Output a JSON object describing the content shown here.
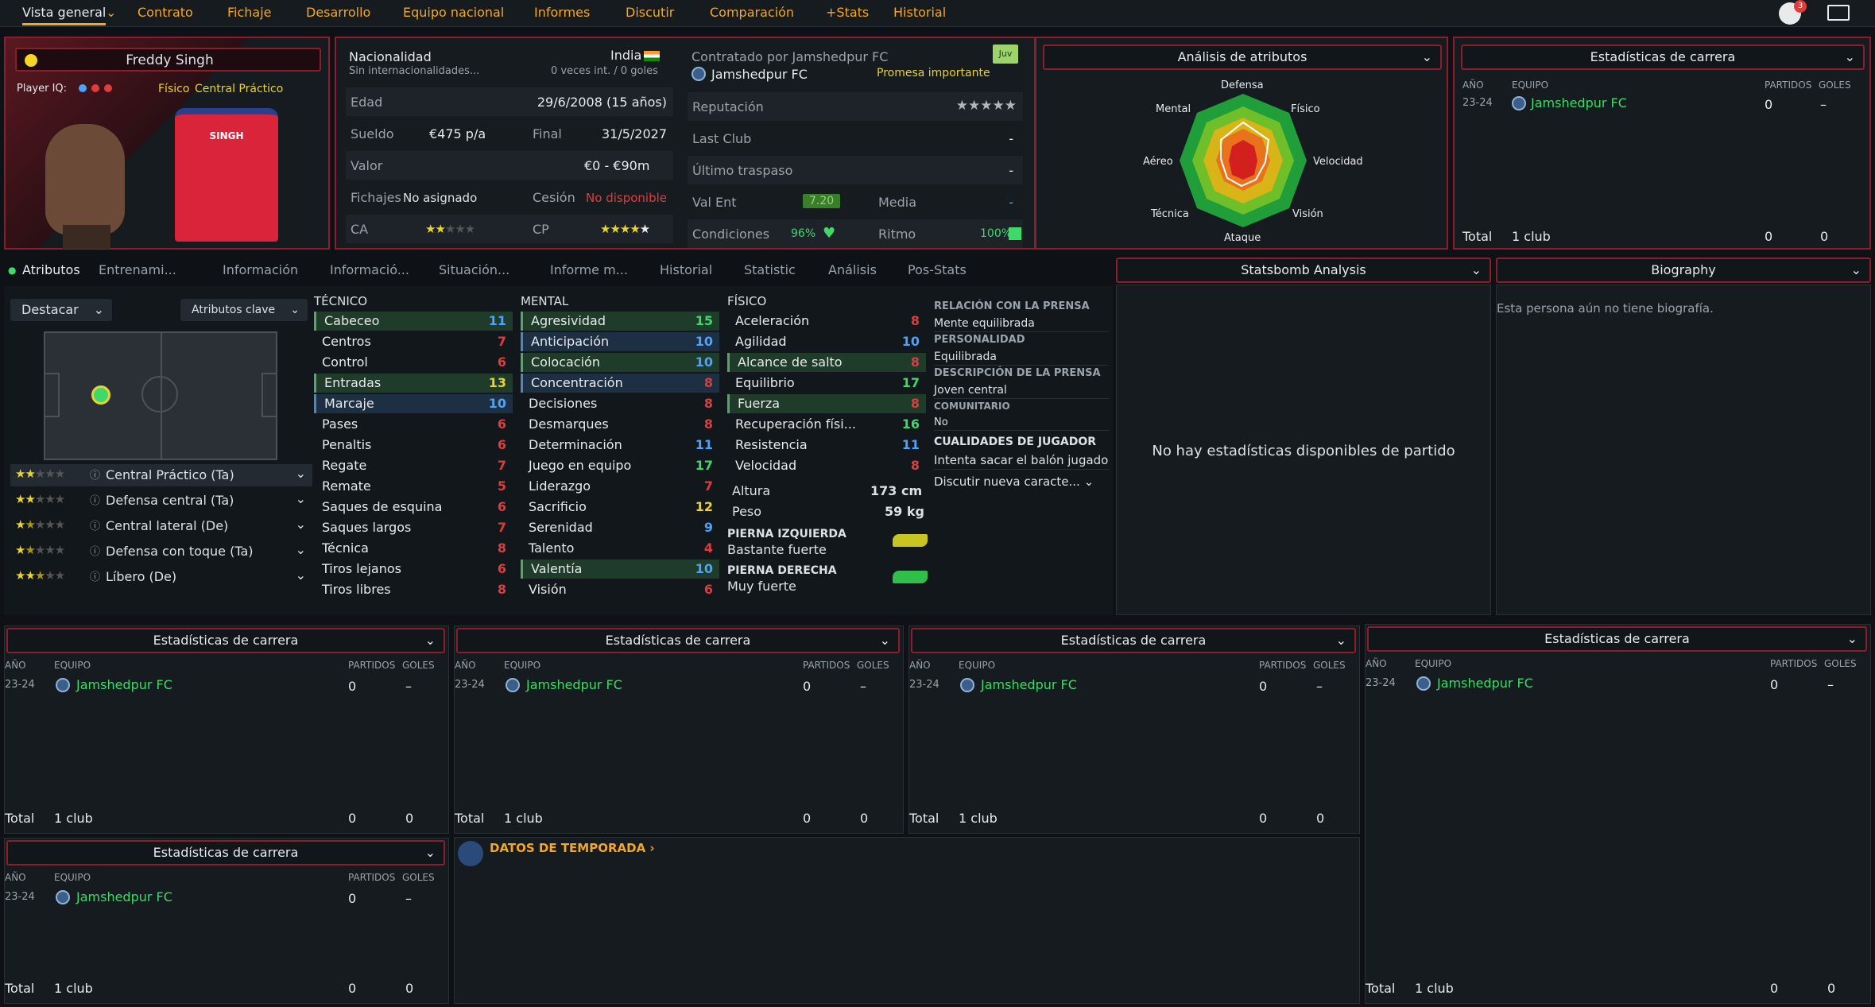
{
  "nav": {
    "items": [
      "Vista general",
      "Contrato",
      "Fichaje",
      "Desarrollo",
      "Equipo nacional",
      "Informes",
      "Discutir",
      "Comparación",
      "+Stats",
      "Historial"
    ],
    "badge": "3"
  },
  "player": {
    "name": "Freddy Singh",
    "iq_label": "Player IQ:",
    "role": "Físico",
    "position": "Central Práctico",
    "shirt": "SINGH"
  },
  "info": {
    "nationality_label": "Nacionalidad",
    "nationality": "India",
    "intl_sub": "Sin internacionalidades...",
    "intl_val": "0 veces int. / 0 goles",
    "age_label": "Edad",
    "age": "29/6/2008 (15 años)",
    "wage_label": "Sueldo",
    "wage": "€475 p/a",
    "end_label": "Final",
    "end": "31/5/2027",
    "value_label": "Valor",
    "value": "€0 - €90m",
    "transfer_label": "Fichajes",
    "transfer": "No asignado",
    "loan_label": "Cesión",
    "loan": "No disponible",
    "ca_label": "CA",
    "cp_label": "CP",
    "ca_stars": 2,
    "cp_stars": 4.5
  },
  "club": {
    "contracted": "Contratado por Jamshedpur FC",
    "club": "Jamshedpur FC",
    "promise": "Promesa importante",
    "badge": "Juv",
    "rep_label": "Reputación",
    "last_club_label": "Last Club",
    "last_club": "-",
    "last_transfer_label": "Último traspaso",
    "last_transfer": "-",
    "valent_label": "Val Ent",
    "valent": "7.20",
    "media_label": "Media",
    "media": "-",
    "cond_label": "Condiciones",
    "cond": "96%",
    "ritmo_label": "Ritmo",
    "ritmo": "100%"
  },
  "radar": {
    "title": "Análisis de atributos",
    "labels": [
      "Defensa",
      "Físico",
      "Velocidad",
      "Visión",
      "Ataque",
      "Técnica",
      "Aéreo",
      "Mental"
    ]
  },
  "career_top": {
    "title": "Estadísticas de carrera",
    "h_year": "AÑO",
    "h_team": "EQUIPO",
    "h_matches": "PARTIDOS",
    "h_goals": "GOLES",
    "year": "23-24",
    "team": "Jamshedpur FC",
    "matches": "0",
    "goals": "–",
    "total": "Total",
    "clubs": "1 club",
    "t_matches": "0",
    "t_goals": "0"
  },
  "tabs": [
    "Atributos",
    "Entrenami...",
    "Información",
    "Informació...",
    "Situación...",
    "Informe m...",
    "Historial",
    "Statistic",
    "Análisis",
    "Pos-Stats"
  ],
  "statsbomb": {
    "title": "Statsbomb Analysis",
    "empty": "No hay estadísticas disponibles de partido"
  },
  "bio": {
    "title": "Biography",
    "text": "Esta persona aún no tiene biografía."
  },
  "left": {
    "highlight": "Destacar",
    "key": "Atributos clave",
    "positions": [
      {
        "name": "Central Práctico (Ta)",
        "stars": 2
      },
      {
        "name": "Defensa central (Ta)",
        "stars": 2
      },
      {
        "name": "Central lateral (De)",
        "stars": 1.5
      },
      {
        "name": "Defensa con toque (Ta)",
        "stars": 1.5
      },
      {
        "name": "Líbero (De)",
        "stars": 2.5
      }
    ]
  },
  "tecnico": {
    "title": "TÉCNICO",
    "attrs": [
      [
        "Cabeceo",
        "11",
        "b",
        "g"
      ],
      [
        "Centros",
        "7",
        "r",
        ""
      ],
      [
        "Control",
        "6",
        "r",
        ""
      ],
      [
        "Entradas",
        "13",
        "y",
        "g"
      ],
      [
        "Marcaje",
        "10",
        "b",
        "b"
      ],
      [
        "Pases",
        "6",
        "r",
        ""
      ],
      [
        "Penaltis",
        "6",
        "r",
        ""
      ],
      [
        "Regate",
        "7",
        "r",
        ""
      ],
      [
        "Remate",
        "5",
        "r",
        ""
      ],
      [
        "Saques de esquina",
        "6",
        "r",
        ""
      ],
      [
        "Saques largos",
        "7",
        "r",
        ""
      ],
      [
        "Técnica",
        "8",
        "r",
        ""
      ],
      [
        "Tiros lejanos",
        "6",
        "r",
        ""
      ],
      [
        "Tiros libres",
        "8",
        "r",
        ""
      ]
    ]
  },
  "mental": {
    "title": "MENTAL",
    "attrs": [
      [
        "Agresividad",
        "15",
        "g",
        "g"
      ],
      [
        "Anticipación",
        "10",
        "b",
        "b"
      ],
      [
        "Colocación",
        "10",
        "b",
        "g"
      ],
      [
        "Concentración",
        "8",
        "r",
        "b"
      ],
      [
        "Decisiones",
        "8",
        "r",
        ""
      ],
      [
        "Desmarques",
        "8",
        "r",
        ""
      ],
      [
        "Determinación",
        "11",
        "b",
        ""
      ],
      [
        "Juego en equipo",
        "17",
        "g",
        ""
      ],
      [
        "Liderazgo",
        "7",
        "r",
        ""
      ],
      [
        "Sacrificio",
        "12",
        "y",
        ""
      ],
      [
        "Serenidad",
        "9",
        "b",
        ""
      ],
      [
        "Talento",
        "4",
        "r",
        ""
      ],
      [
        "Valentía",
        "10",
        "b",
        "g"
      ],
      [
        "Visión",
        "6",
        "r",
        ""
      ]
    ]
  },
  "fisico": {
    "title": "FÍSICO",
    "attrs": [
      [
        "Aceleración",
        "8",
        "r",
        ""
      ],
      [
        "Agilidad",
        "10",
        "b",
        ""
      ],
      [
        "Alcance de salto",
        "8",
        "r",
        "g"
      ],
      [
        "Equilibrio",
        "17",
        "g",
        ""
      ],
      [
        "Fuerza",
        "8",
        "r",
        "g"
      ],
      [
        "Recuperación físi...",
        "16",
        "g",
        ""
      ],
      [
        "Resistencia",
        "11",
        "b",
        ""
      ],
      [
        "Velocidad",
        "8",
        "r",
        ""
      ]
    ],
    "height_label": "Altura",
    "height": "173 cm",
    "weight_label": "Peso",
    "weight": "59 kg",
    "left_foot_label": "PIERNA IZQUIERDA",
    "left_foot": "Bastante fuerte",
    "right_foot_label": "PIERNA DERECHA",
    "right_foot": "Muy fuerte"
  },
  "press": {
    "rel_label": "RELACIÓN CON LA PRENSA",
    "rel": "Mente equilibrada",
    "pers_label": "PERSONALIDAD",
    "pers": "Equilibrada",
    "desc_label": "DESCRIPCIÓN DE LA PRENSA",
    "desc": "Joven central",
    "com_label": "COMUNITARIO",
    "com": "No",
    "qual_label": "CUALIDADES DE JUGADOR",
    "qual": "Intenta sacar el balón jugado",
    "discuss": "Discutir nueva caracte..."
  },
  "season": {
    "title": "DATOS DE TEMPORADA"
  },
  "colors": {
    "accent": "#f5a623",
    "red": "#e23b3b",
    "green": "#3fd96a",
    "blue": "#4aa3ff",
    "yellow": "#e8d23a"
  }
}
